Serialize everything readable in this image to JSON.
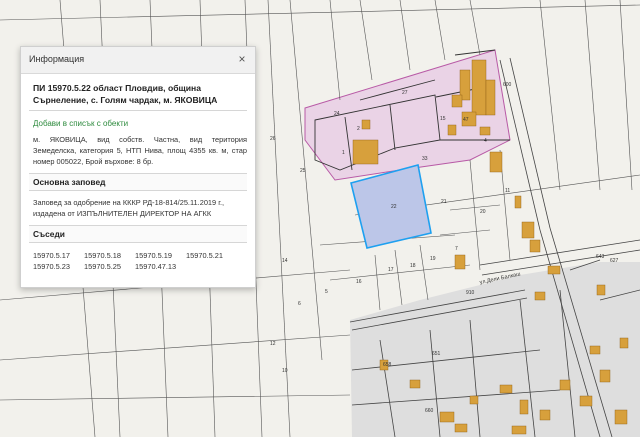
{
  "panel": {
    "title": "Информация",
    "close_glyph": "×",
    "heading": "ПИ 15970.5.22 област Пловдив, община Сърнеление, с. Голям чардак, м. ЯКОВИЦА",
    "add_link": "Добави в списък с обекти",
    "description": "м. ЯКОВИЦА, вид собств. Частна, вид територия Земеделска, категория 5, НТП Нива, площ 4355 кв. м, стар номер 005022, Брой върхове: 8 бр.",
    "order_title": "Основна заповед",
    "order_text": "Заповед за одобрение на КККР РД-18-814/25.11.2019 г., издадена от ИЗПЪЛНИТЕЛЕН ДИРЕКТОР НА АГКК",
    "neighbors_title": "Съседи",
    "neighbors": [
      "15970.5.17",
      "15970.5.18",
      "15970.5.19",
      "15970.5.21",
      "15970.5.23",
      "15970.5.25",
      "15970.47.13"
    ]
  },
  "map": {
    "labels": {
      "l24": "24",
      "l27": "27",
      "l15": "15",
      "l47": "47",
      "l2": "2",
      "l1": "1",
      "l33": "33",
      "l4": "4",
      "l22": "22",
      "l21": "21",
      "l20": "20",
      "l25": "25",
      "l26": "26",
      "l11": "11",
      "l7": "7",
      "l17": "17",
      "l16": "16",
      "l18": "18",
      "l19": "19",
      "l14": "14",
      "l600": "600",
      "l910": "910",
      "l658": "658",
      "l651": "651",
      "l660": "660",
      "l627": "627",
      "l643": "643",
      "l5": "5",
      "l6": "6",
      "l10": "10",
      "l12": "12",
      "street": "ул.Дели Балкаш"
    },
    "colors": {
      "highlight_fill": "#bcc6e8",
      "highlight_stroke": "#1ea0f0",
      "pink_fill": "#ead3e6",
      "building": "#d7a03c",
      "village": "#dedede",
      "parcel_line": "#555555"
    }
  }
}
